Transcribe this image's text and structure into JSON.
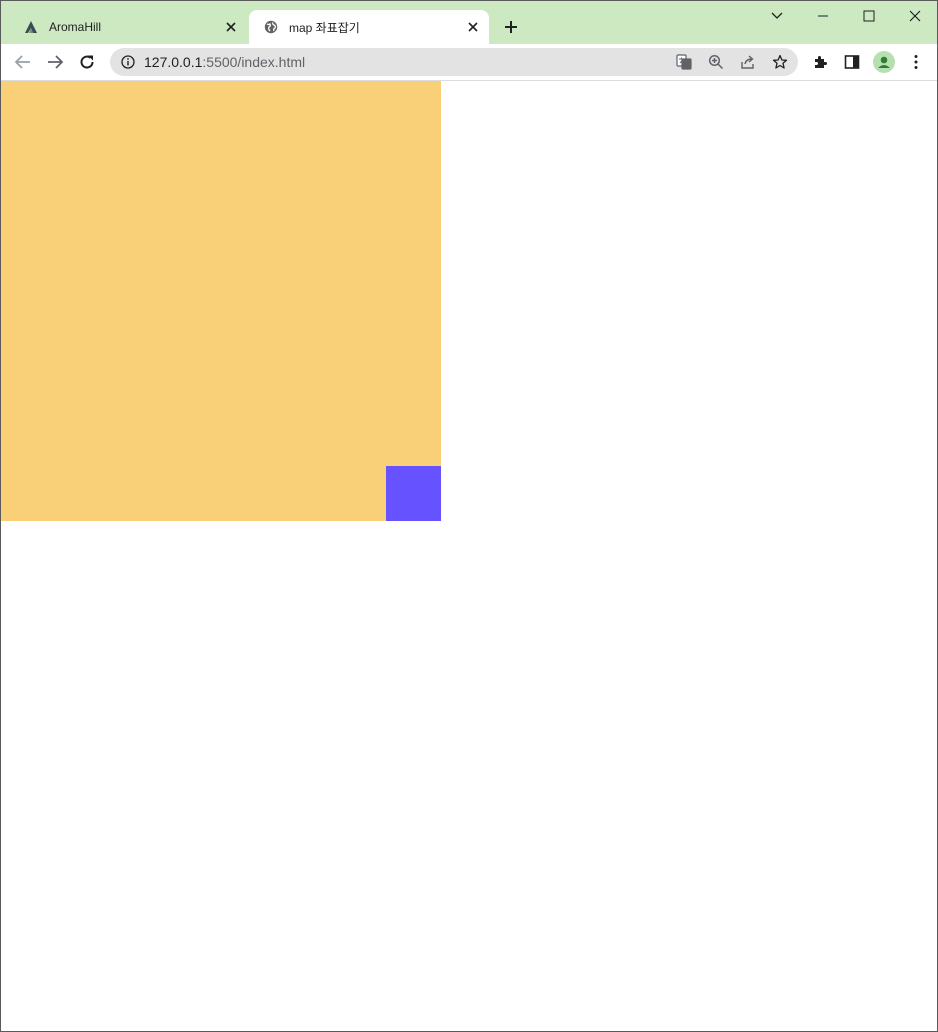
{
  "browser": {
    "tabs": [
      {
        "title": "AromaHill",
        "favicon": "aromahill-logo-icon",
        "active": false
      },
      {
        "title": "map 좌표잡기",
        "favicon": "globe-icon",
        "active": true
      }
    ],
    "address": {
      "host": "127.0.0.1",
      "path": ":5500/index.html"
    },
    "colors": {
      "tabstrip": "#cce9c1",
      "omnibox": "#e3e3e3"
    }
  },
  "page": {
    "map_color": "#f9d077",
    "marker_color": "#6653ff"
  }
}
